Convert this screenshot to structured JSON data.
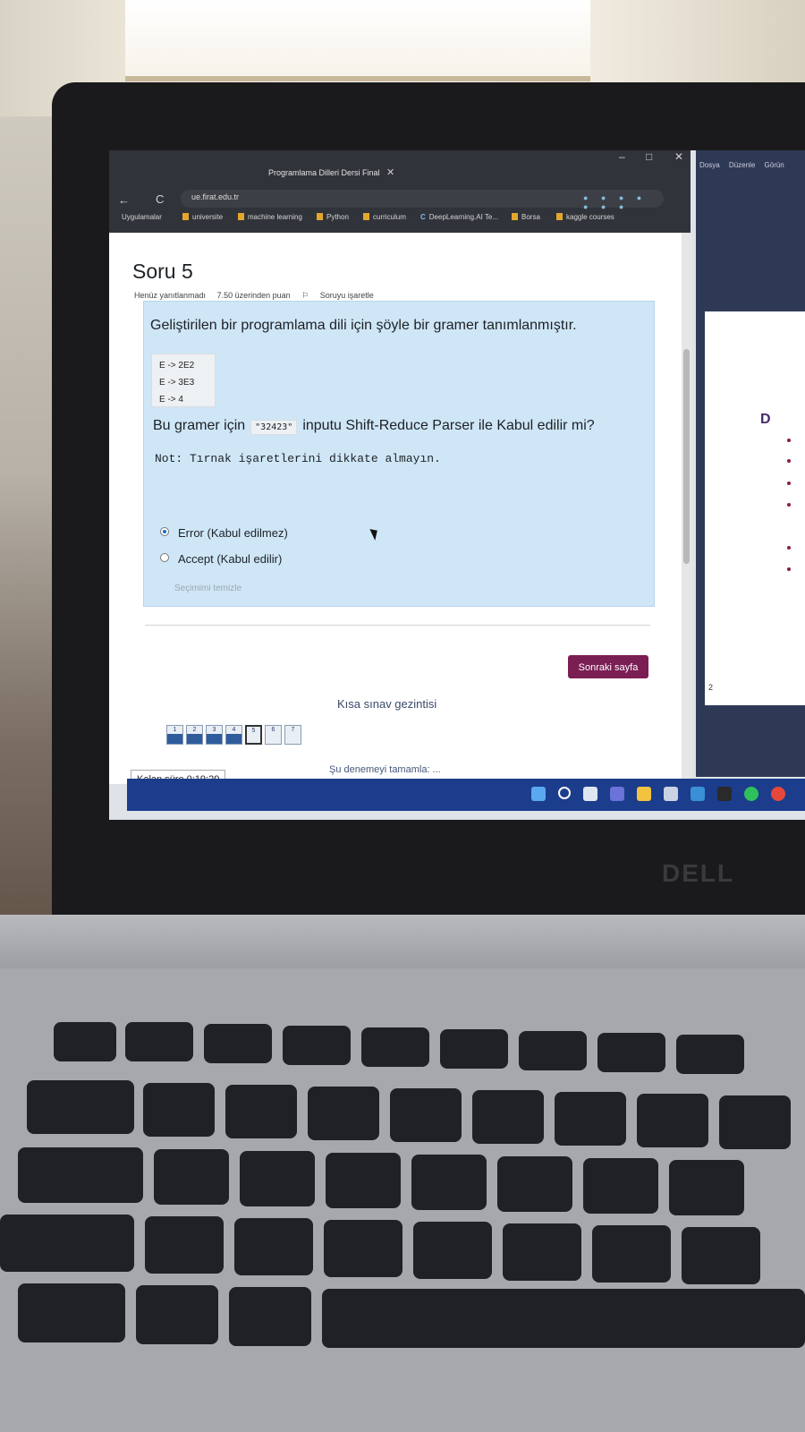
{
  "browser": {
    "tab_title": "Programlama Dilleri Dersi Final",
    "tab_close": "✕",
    "url": "ue.firat.edu.tr",
    "back_icon": "←",
    "reload_icon": "C",
    "window_controls": {
      "minimize": "–",
      "maximize": "□",
      "close": "✕"
    },
    "bookmarks": [
      {
        "label": "Uygulamalar",
        "type": "apps"
      },
      {
        "label": "universite",
        "type": "folder"
      },
      {
        "label": "machine learning",
        "type": "folder"
      },
      {
        "label": "Python",
        "type": "folder"
      },
      {
        "label": "curriculum",
        "type": "folder"
      },
      {
        "label": "DeepLearning.AI Te...",
        "type": "site"
      },
      {
        "label": "Borsa",
        "type": "folder"
      },
      {
        "label": "kaggle courses",
        "type": "folder"
      }
    ]
  },
  "question": {
    "title": "Soru 5",
    "status": "Henüz yanıtlanmadı",
    "points": "7.50 üzerinden puan",
    "flag_label": "Soruyu işaretle",
    "text": "Geliştirilen bir programlama dili için şöyle bir gramer tanımlanmıştır.",
    "grammar": [
      "E -> 2E2",
      "E -> 3E3",
      "E -> 4"
    ],
    "text2_before": "Bu gramer için",
    "input_code": "\"32423\"",
    "text2_after": "inputu Shift-Reduce Parser ile Kabul edilir mi?",
    "note": "Not: Tırnak işaretlerini dikkate almayın.",
    "options": [
      {
        "label": "Error (Kabul edilmez)",
        "selected": true
      },
      {
        "label": "Accept (Kabul edilir)",
        "selected": false
      }
    ],
    "clear_choice": "Seçimimi temizle"
  },
  "next_button": "Sonraki sayfa",
  "quiz_nav": {
    "title": "Kısa sınav gezintisi",
    "questions": [
      {
        "num": "1",
        "answered": true,
        "current": false
      },
      {
        "num": "2",
        "answered": true,
        "current": false
      },
      {
        "num": "3",
        "answered": true,
        "current": false
      },
      {
        "num": "4",
        "answered": true,
        "current": false
      },
      {
        "num": "5",
        "answered": false,
        "current": true
      },
      {
        "num": "6",
        "answered": false,
        "current": false
      },
      {
        "num": "7",
        "answered": false,
        "current": false
      }
    ],
    "finish": "Şu denemeyi tamamla: ..."
  },
  "timer": "Kalan süre 0:19:29",
  "side_window": {
    "menu": [
      "Dosya",
      "Düzenle",
      "Görün"
    ],
    "slide_heading": "D",
    "slide_number": "2"
  },
  "laptop_brand": "DELL",
  "colors": {
    "next_button": "#7a1e54",
    "question_box": "#cfe6f7",
    "taskbar": "#1c3d8c",
    "nav_fill": "#2f5c9c"
  }
}
